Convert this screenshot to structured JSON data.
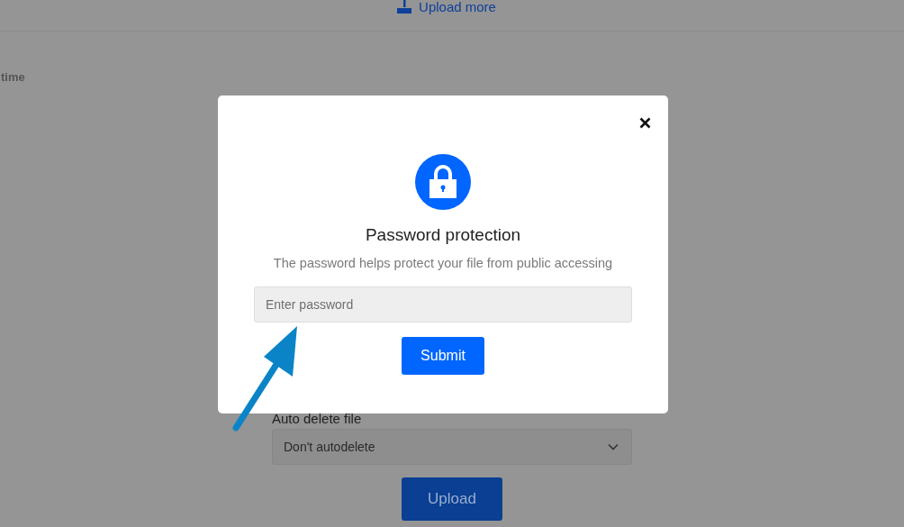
{
  "page": {
    "upload_more_link": "Upload more",
    "column_label": "time",
    "auto_delete": {
      "label": "Auto delete file",
      "value": "Don't autodelete"
    },
    "upload_button": "Upload"
  },
  "dialog": {
    "title": "Password protection",
    "description": "The password helps protect your file from public accessing",
    "password_field": {
      "placeholder": "Enter password"
    },
    "submit_button": "Submit"
  }
}
